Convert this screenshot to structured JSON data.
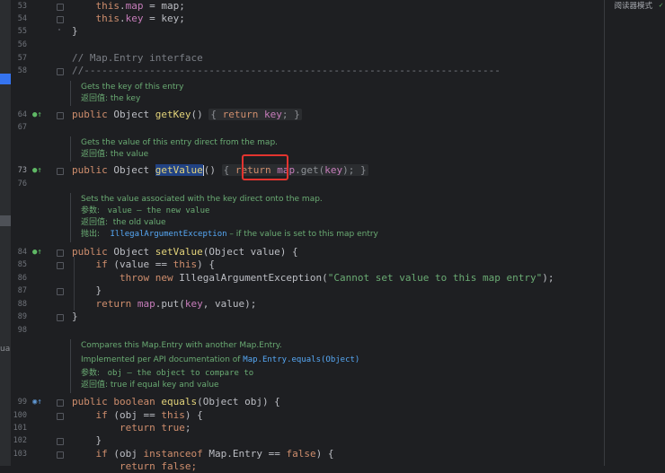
{
  "reader_mode_label": "阅读器模式",
  "left_strip_fragment": "ual",
  "lines": [
    {
      "n": "53",
      "code": [
        {
          "t": "    "
        },
        {
          "t": "this",
          "c": "kw"
        },
        {
          "t": "."
        },
        {
          "t": "map",
          "c": "fld"
        },
        {
          "t": " = map;"
        }
      ]
    },
    {
      "n": "54",
      "code": [
        {
          "t": "    "
        },
        {
          "t": "this",
          "c": "kw"
        },
        {
          "t": "."
        },
        {
          "t": "key",
          "c": "fld"
        },
        {
          "t": " = key;"
        }
      ]
    },
    {
      "n": "55",
      "code": [
        {
          "t": "}"
        }
      ]
    },
    {
      "n": "56",
      "code": []
    },
    {
      "n": "57",
      "code": [
        {
          "t": "// Map.Entry interface",
          "c": "cm"
        }
      ]
    },
    {
      "n": "58",
      "code": [
        {
          "t": "//----------------------------------------------------------------------",
          "c": "cm"
        }
      ]
    },
    {
      "n": "64",
      "code": [
        {
          "t": "public ",
          "c": "kw"
        },
        {
          "t": "Object "
        },
        {
          "t": "getKey",
          "c": "fnd"
        },
        {
          "t": "() "
        },
        {
          "t": "{ return key; }",
          "c": "fold"
        }
      ]
    },
    {
      "n": "67",
      "code": []
    },
    {
      "n": "73",
      "code": [
        {
          "t": "public ",
          "c": "kw"
        },
        {
          "t": "Object "
        },
        {
          "t": "getValue",
          "c": "sel"
        },
        {
          "t": "() "
        },
        {
          "t": "{ return map.get(key); }",
          "c": "fold"
        }
      ]
    },
    {
      "n": "76",
      "code": []
    },
    {
      "n": "84",
      "code": [
        {
          "t": "public ",
          "c": "kw"
        },
        {
          "t": "Object "
        },
        {
          "t": "setValue",
          "c": "fnd"
        },
        {
          "t": "(Object value) {"
        }
      ]
    },
    {
      "n": "85",
      "code": [
        {
          "t": "    "
        },
        {
          "t": "if",
          "c": "kw"
        },
        {
          "t": " (value == "
        },
        {
          "t": "this",
          "c": "kw"
        },
        {
          "t": ") {"
        }
      ]
    },
    {
      "n": "86",
      "code": [
        {
          "t": "        "
        },
        {
          "t": "throw new",
          "c": "kw"
        },
        {
          "t": " IllegalArgumentException("
        },
        {
          "t": "\"Cannot set value to this map entry\"",
          "c": "str"
        },
        {
          "t": ");"
        }
      ]
    },
    {
      "n": "87",
      "code": [
        {
          "t": "    }"
        }
      ]
    },
    {
      "n": "88",
      "code": [
        {
          "t": "    "
        },
        {
          "t": "return ",
          "c": "kw"
        },
        {
          "t": "map",
          "c": "fld"
        },
        {
          "t": ".put("
        },
        {
          "t": "key",
          "c": "fld"
        },
        {
          "t": ", value);"
        }
      ]
    },
    {
      "n": "89",
      "code": [
        {
          "t": "}"
        }
      ]
    },
    {
      "n": "98",
      "code": []
    },
    {
      "n": "99",
      "code": [
        {
          "t": "public boolean ",
          "c": "kw"
        },
        {
          "t": "equals",
          "c": "fnd"
        },
        {
          "t": "(Object obj) {"
        }
      ]
    },
    {
      "n": "100",
      "code": [
        {
          "t": "    "
        },
        {
          "t": "if",
          "c": "kw"
        },
        {
          "t": " (obj == "
        },
        {
          "t": "this",
          "c": "kw"
        },
        {
          "t": ") {"
        }
      ]
    },
    {
      "n": "101",
      "code": [
        {
          "t": "        "
        },
        {
          "t": "return true",
          "c": "kw"
        },
        {
          "t": ";"
        }
      ]
    },
    {
      "n": "102",
      "code": [
        {
          "t": "    }"
        }
      ]
    },
    {
      "n": "103",
      "code": [
        {
          "t": "    "
        },
        {
          "t": "if",
          "c": "kw"
        },
        {
          "t": " (obj "
        },
        {
          "t": "instanceof",
          "c": "kw"
        },
        {
          "t": " Map.Entry == "
        },
        {
          "t": "false",
          "c": "kw"
        },
        {
          "t": ") {"
        }
      ]
    },
    {
      "n": "",
      "code": [
        {
          "t": "        "
        },
        {
          "t": "return false;",
          "c": "kw"
        }
      ]
    }
  ],
  "docs": {
    "getKey": [
      "Gets the key of this entry",
      "返回值: the key"
    ],
    "getValue": [
      "Gets the value of this entry direct from the map.",
      "返回值: the value"
    ],
    "setValue": {
      "summary": "Sets the value associated with the key direct onto the map.",
      "param_label": "参数:",
      "param_value": "value – the new value",
      "return_label": "返回值:",
      "return_value": "the old value",
      "throws_label": "抛出:",
      "throws_link": "IllegalArgumentException",
      "throws_value": " – if the value is set to this map entry"
    },
    "equals": {
      "summary": "Compares this Map.Entry with another Map.Entry.",
      "impl_prefix": "Implemented per API documentation of ",
      "impl_link": "Map.Entry.equals(Object)",
      "param_label": "参数:",
      "param_value": "obj – the object to compare to",
      "return_value": "返回值: true if equal key and value"
    }
  },
  "colors": {
    "keyword": "#cf8e6d",
    "field": "#c77dbb",
    "method_decl": "#e3d37a",
    "string": "#6aab73",
    "comment": "#7a7e85",
    "doc": "#6aab73",
    "highlight_box": "#e3342f",
    "selection": "#214283"
  }
}
